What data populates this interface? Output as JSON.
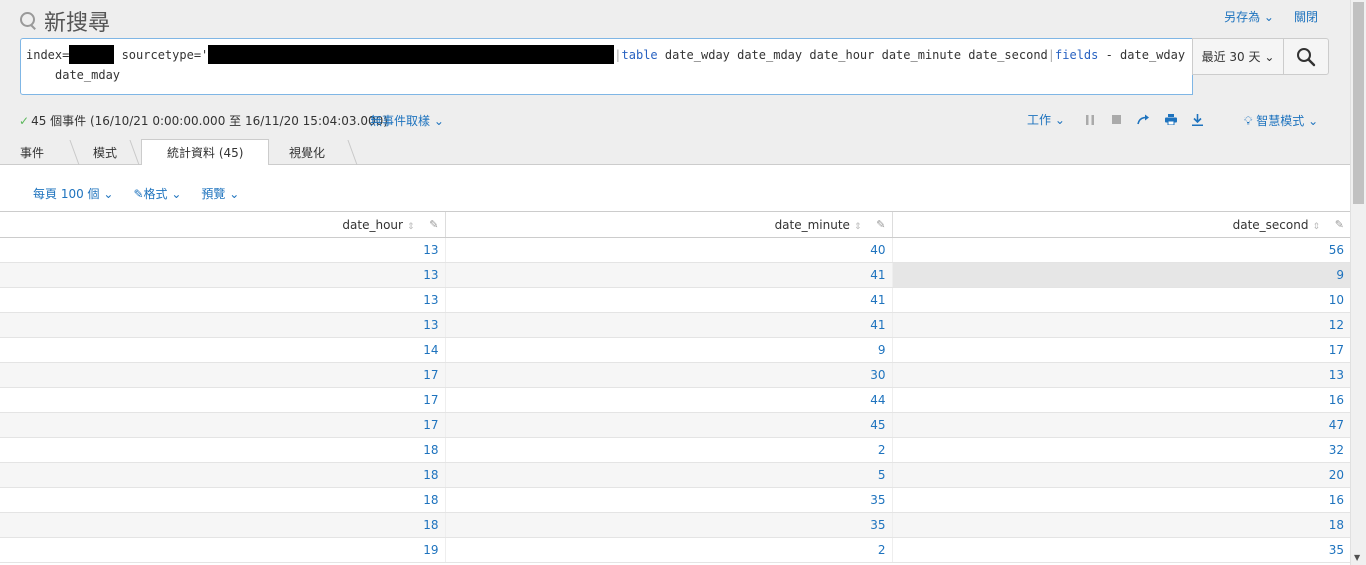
{
  "header": {
    "title": "新搜尋",
    "save_as": "另存為",
    "close": "關閉"
  },
  "search": {
    "p1": "index=",
    "p2": " sourcetype='",
    "table_kw": "table",
    "table_args": " date_wday date_mday date_hour date_minute date_second",
    "fields_kw": "fields",
    "fields_args": " - date_wday",
    "line2": "date_mday",
    "time_range": "最近 30 天"
  },
  "status": {
    "events": "45 個事件 (16/10/21 0:00:00.000 至 16/11/20 15:04:03.000)",
    "sampling": "無事件取樣",
    "job": "工作",
    "mode": "智慧模式"
  },
  "tabs": [
    {
      "label": "事件"
    },
    {
      "label": "模式"
    },
    {
      "label": "統計資料 (45)"
    },
    {
      "label": "視覺化"
    }
  ],
  "toolbar": {
    "per_page": "每頁 100 個",
    "format": "格式",
    "preview": "預覽"
  },
  "table": {
    "columns": [
      "date_hour",
      "date_minute",
      "date_second"
    ],
    "rows": [
      [
        "13",
        "40",
        "56"
      ],
      [
        "13",
        "41",
        "9"
      ],
      [
        "13",
        "41",
        "10"
      ],
      [
        "13",
        "41",
        "12"
      ],
      [
        "14",
        "9",
        "17"
      ],
      [
        "17",
        "30",
        "13"
      ],
      [
        "17",
        "44",
        "16"
      ],
      [
        "17",
        "45",
        "47"
      ],
      [
        "18",
        "2",
        "32"
      ],
      [
        "18",
        "5",
        "20"
      ],
      [
        "18",
        "35",
        "16"
      ],
      [
        "18",
        "35",
        "18"
      ],
      [
        "19",
        "2",
        "35"
      ]
    ]
  }
}
